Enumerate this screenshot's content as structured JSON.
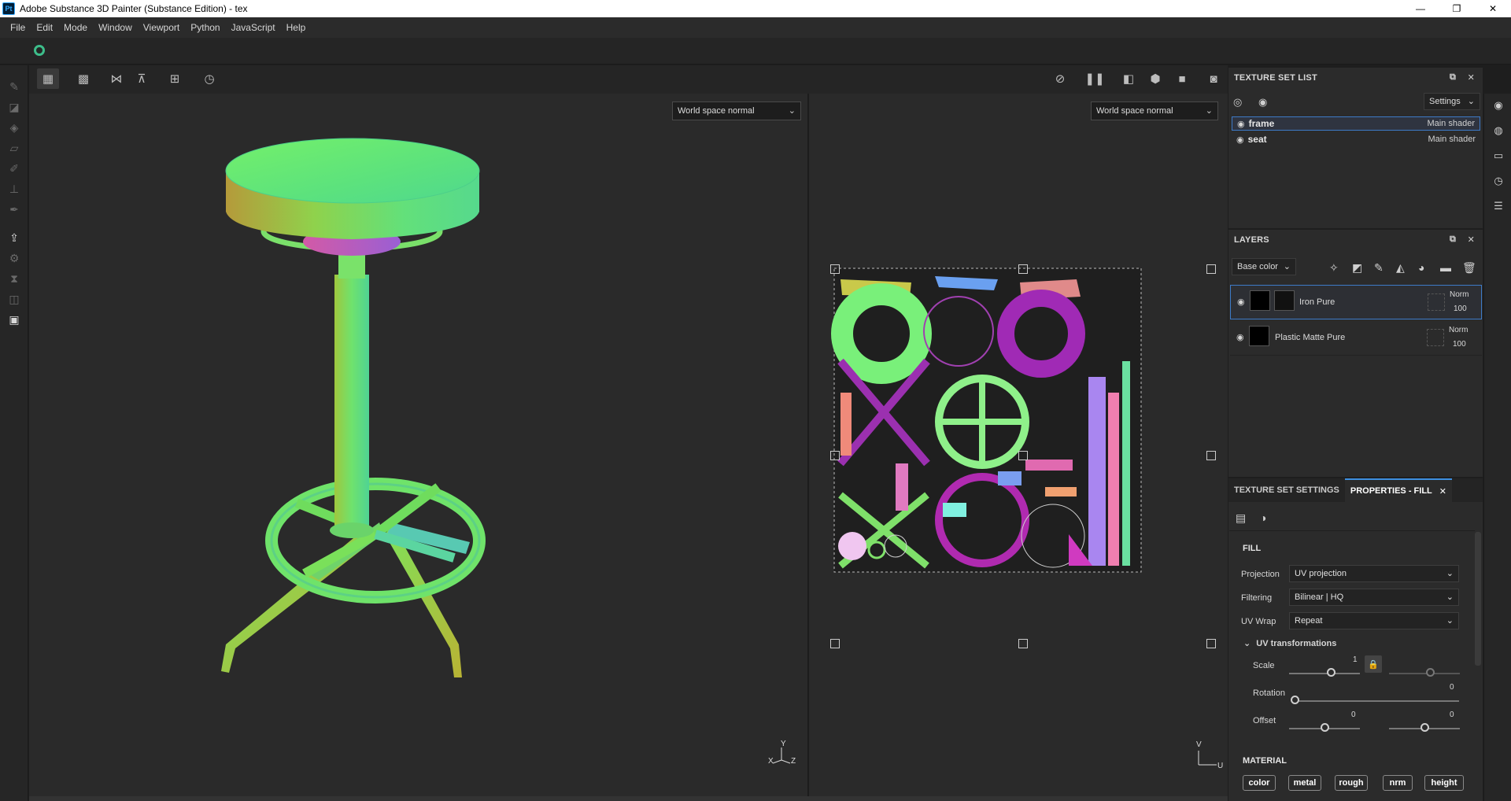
{
  "window": {
    "app_logo": "Pt",
    "title": "Adobe Substance 3D Painter (Substance Edition) - tex",
    "controls": [
      "—",
      "❐",
      "✕"
    ]
  },
  "menu": [
    "File",
    "Edit",
    "Mode",
    "Window",
    "Viewport",
    "Python",
    "JavaScript",
    "Help"
  ],
  "viewport": {
    "left_mode": "World space normal",
    "right_mode": "World space normal",
    "axis_3d": {
      "y": "Y",
      "x": "X",
      "z": "Z"
    },
    "axis_2d": {
      "v": "V",
      "u": "U"
    }
  },
  "texture_set_list": {
    "title": "TEXTURE SET LIST",
    "settings_label": "Settings",
    "items": [
      {
        "name": "frame",
        "shader": "Main shader"
      },
      {
        "name": "seat",
        "shader": "Main shader"
      }
    ]
  },
  "layers": {
    "title": "LAYERS",
    "channel": "Base color",
    "items": [
      {
        "name": "Iron Pure",
        "blend": "Norm",
        "opacity": "100"
      },
      {
        "name": "Plastic Matte Pure",
        "blend": "Norm",
        "opacity": "100"
      }
    ]
  },
  "properties": {
    "tab_texture_set": "TEXTURE SET SETTINGS",
    "tab_properties": "PROPERTIES - FILL",
    "tab_close": "✕",
    "section_fill": "FILL",
    "projection_label": "Projection",
    "projection_value": "UV projection",
    "filtering_label": "Filtering",
    "filtering_value": "Bilinear | HQ",
    "uvwrap_label": "UV Wrap",
    "uvwrap_value": "Repeat",
    "uv_transform_label": "UV transformations",
    "scale_label": "Scale",
    "scale_value": "1",
    "rotation_label": "Rotation",
    "rotation_value": "0",
    "offset_label": "Offset",
    "offset_u": "0",
    "offset_v": "0",
    "section_material": "MATERIAL",
    "channels": [
      "color",
      "metal",
      "rough",
      "nrm",
      "height"
    ]
  },
  "colors": {
    "accent": "#3d8fe0",
    "selection": "#3d7ac7",
    "ring": "#3dbd8a"
  }
}
